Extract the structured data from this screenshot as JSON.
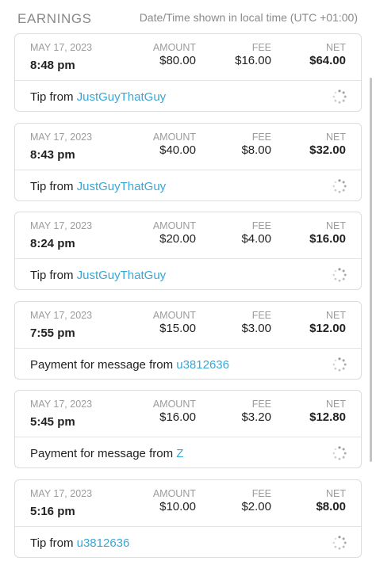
{
  "header": {
    "title": "EARNINGS",
    "timezone_note": "Date/Time shown in local time (UTC +01:00)"
  },
  "labels": {
    "amount": "AMOUNT",
    "fee": "FEE",
    "net": "NET"
  },
  "icons": {
    "pending": "loading-spinner-icon"
  },
  "colors": {
    "link": "#3aa6d6",
    "muted": "#9c9c9c"
  },
  "earnings": [
    {
      "date": "MAY 17, 2023",
      "time": "8:48 pm",
      "amount": "$80.00",
      "fee": "$16.00",
      "net": "$64.00",
      "desc_prefix": "Tip from ",
      "user": "JustGuyThatGuy"
    },
    {
      "date": "MAY 17, 2023",
      "time": "8:43 pm",
      "amount": "$40.00",
      "fee": "$8.00",
      "net": "$32.00",
      "desc_prefix": "Tip from ",
      "user": "JustGuyThatGuy"
    },
    {
      "date": "MAY 17, 2023",
      "time": "8:24 pm",
      "amount": "$20.00",
      "fee": "$4.00",
      "net": "$16.00",
      "desc_prefix": "Tip from ",
      "user": "JustGuyThatGuy"
    },
    {
      "date": "MAY 17, 2023",
      "time": "7:55 pm",
      "amount": "$15.00",
      "fee": "$3.00",
      "net": "$12.00",
      "desc_prefix": "Payment for message from ",
      "user": "u3812636"
    },
    {
      "date": "MAY 17, 2023",
      "time": "5:45 pm",
      "amount": "$16.00",
      "fee": "$3.20",
      "net": "$12.80",
      "desc_prefix": "Payment for message from ",
      "user": "Z"
    },
    {
      "date": "MAY 17, 2023",
      "time": "5:16 pm",
      "amount": "$10.00",
      "fee": "$2.00",
      "net": "$8.00",
      "desc_prefix": "Tip from ",
      "user": "u3812636"
    }
  ]
}
